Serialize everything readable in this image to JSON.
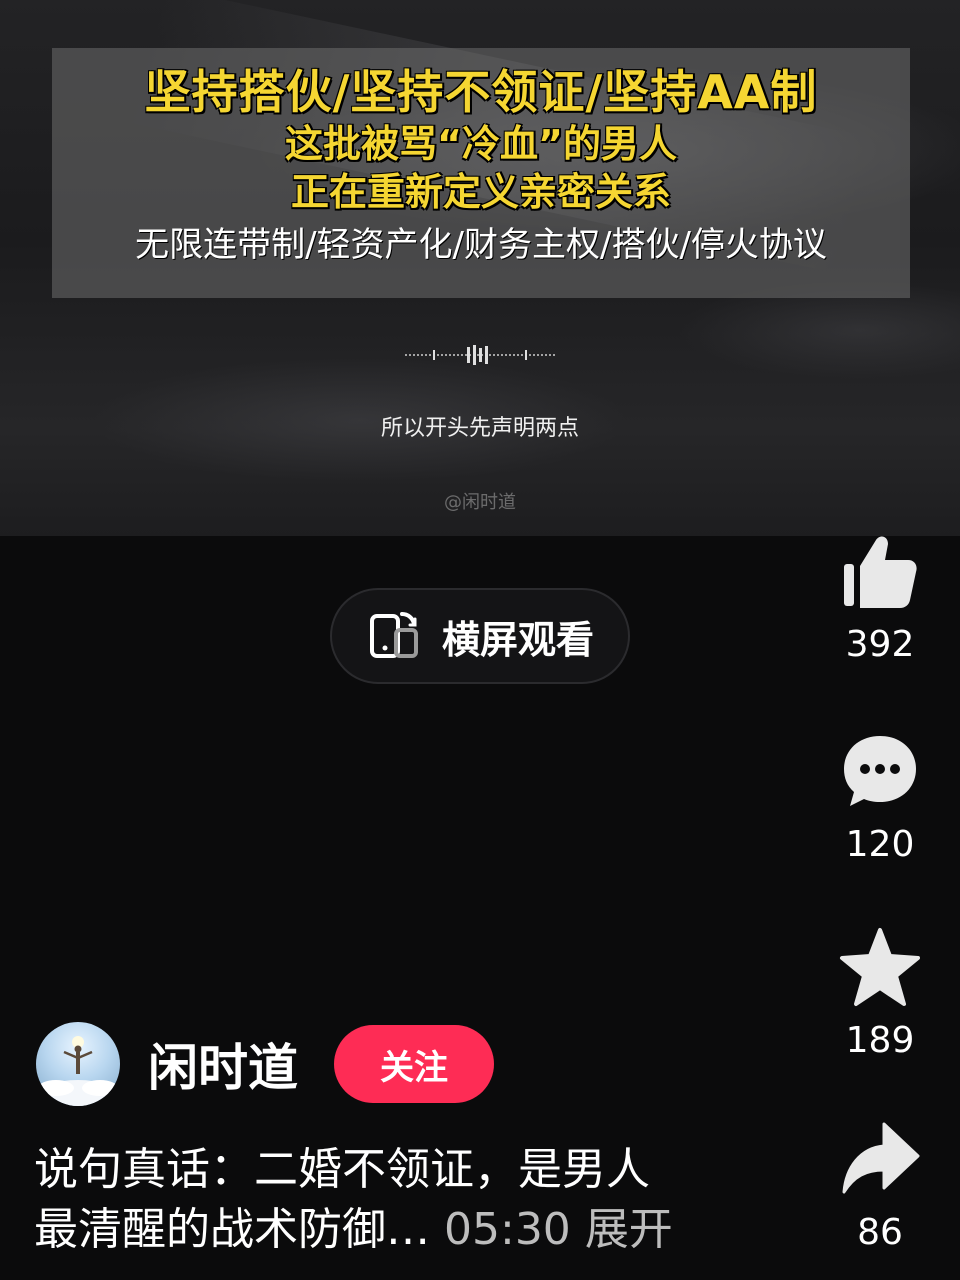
{
  "video": {
    "caption_line1": "坚持搭伙/坚持不领证/坚持AA制",
    "caption_line2": "这批被骂“冷血”的男人",
    "caption_line3": "正在重新定义亲密关系",
    "caption_line4": "无限连带制/轻资产化/财务主权/搭伙/停火协议",
    "subtitle": "所以开头先声明两点",
    "watermark": "@闲时道"
  },
  "landscape_button": {
    "label": "横屏观看",
    "icon": "rotate-screen-icon"
  },
  "actions": [
    {
      "icon": "thumbs-up-icon",
      "count": "392"
    },
    {
      "icon": "comment-icon",
      "count": "120"
    },
    {
      "icon": "star-icon",
      "count": "189"
    },
    {
      "icon": "share-icon",
      "count": "86"
    }
  ],
  "author": {
    "name": "闲时道",
    "follow_label": "关注"
  },
  "description": {
    "line1": "说句真话：二婚不领证，是男人",
    "line2": "最清醒的战术防御…",
    "duration": "05:30",
    "expand_label": "展开"
  },
  "colors": {
    "accent": "#fe2c55",
    "caption_yellow": "#f5d632",
    "background": "#0b0b0c"
  }
}
